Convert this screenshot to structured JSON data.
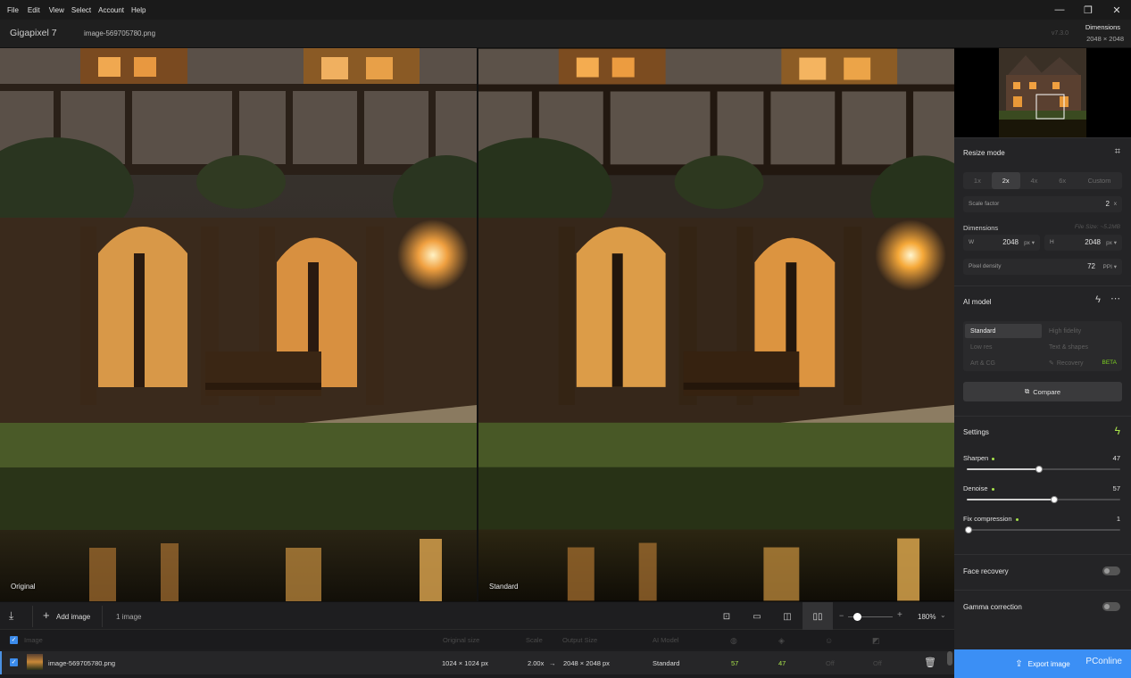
{
  "menu": [
    "File",
    "Edit",
    "View",
    "Select",
    "Account",
    "Help"
  ],
  "window_controls": {
    "minimize": "—",
    "restore": "❐",
    "close": "✕"
  },
  "titlebar": {
    "app_title": "Gigapixel 7",
    "file_name": "image-569705780.png",
    "version": "v7.3.0",
    "dimensions_label": "Dimensions",
    "dimensions_value": "2048 × 2048"
  },
  "preview": {
    "left_label": "Original",
    "right_label": "Standard"
  },
  "resize": {
    "title": "Resize mode",
    "scales": [
      "1x",
      "2x",
      "4x",
      "6x",
      "Custom"
    ],
    "active_scale": "2x",
    "scale_factor_label": "Scale factor",
    "scale_factor_value": "2",
    "scale_factor_unit": "x",
    "dimensions_label": "Dimensions",
    "file_size": "File Size: ~5.2MB",
    "w_label": "W",
    "w_value": "2048",
    "w_unit": "px ▾",
    "h_label": "H",
    "h_value": "2048",
    "h_unit": "px ▾",
    "density_label": "Pixel density",
    "density_value": "72",
    "density_unit": "PPI ▾"
  },
  "ai_model": {
    "title": "AI model",
    "models": [
      "Standard",
      "High fidelity",
      "Low res",
      "Text & shapes",
      "Art & CG",
      "Recovery"
    ],
    "active": "Standard",
    "beta": "BETA",
    "compare": "Compare"
  },
  "settings": {
    "title": "Settings",
    "sharpen_label": "Sharpen",
    "sharpen_value": 47,
    "denoise_label": "Denoise",
    "denoise_value": 57,
    "fix_label": "Fix compression",
    "fix_value": 1,
    "face_recovery": "Face recovery",
    "gamma": "Gamma correction"
  },
  "toolbar": {
    "add_image": "Add image",
    "image_count": "1 image",
    "zoom": "180%"
  },
  "table": {
    "headers": [
      "Image",
      "Original size",
      "Scale",
      "Output Size",
      "AI Model"
    ],
    "row": {
      "name": "image-569705780.png",
      "original_size": "1024 × 1024 px",
      "scale": "2.00x",
      "arrow": "→",
      "output_size": "2048 × 2048 px",
      "model": "Standard",
      "denoise": "57",
      "sharpen": "47",
      "face": "Off",
      "gamma": "Off"
    }
  },
  "export": {
    "label": "Export image"
  },
  "watermark": "PConline",
  "colors": {
    "accent": "#3b8ff5",
    "green": "#a8e34b",
    "beta": "#7ed321"
  }
}
